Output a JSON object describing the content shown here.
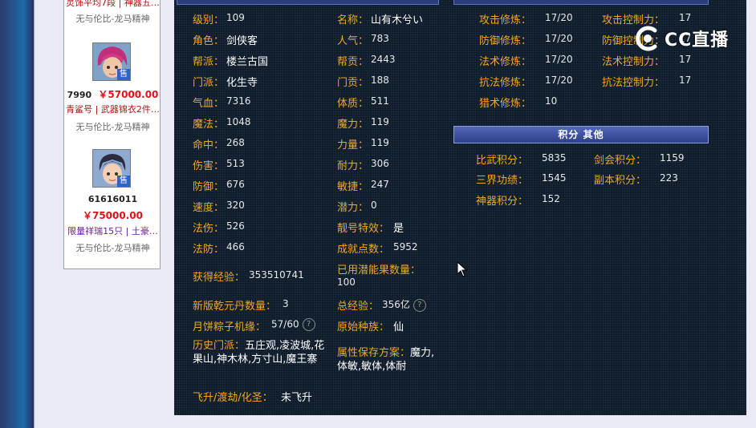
{
  "sidebar": {
    "top_cut_text": "灵饰平均7段 | 神器五…",
    "seller_name": "无与伦比-龙马精神",
    "item1": {
      "id": "7990",
      "price": "￥57000.00",
      "desc": "青鲨号 | 武器锦衣2件…",
      "seller": "无与伦比-龙马精神",
      "badge": "售"
    },
    "item2": {
      "id": "61616011",
      "price": "￥75000.00",
      "desc": "限量祥瑞15只 | 土豪…",
      "seller": "无与伦比-龙马精神",
      "badge": "售"
    }
  },
  "stats": {
    "level": {
      "label": "级别：",
      "value": "109"
    },
    "name": {
      "label": "名称：",
      "value": "山有木兮い"
    },
    "role": {
      "label": "角色：",
      "value": "剑侠客"
    },
    "popularity": {
      "label": "人气：",
      "value": "783"
    },
    "gang": {
      "label": "帮派：",
      "value": "楼兰古国"
    },
    "gang_contrib": {
      "label": "帮贡：",
      "value": "2443"
    },
    "school": {
      "label": "门派：",
      "value": "化生寺"
    },
    "school_contrib": {
      "label": "门贡：",
      "value": "188"
    },
    "hp": {
      "label": "气血：",
      "value": "7316"
    },
    "physique": {
      "label": "体质：",
      "value": "511"
    },
    "mp": {
      "label": "魔法：",
      "value": "1048"
    },
    "magic": {
      "label": "魔力：",
      "value": "119"
    },
    "hit": {
      "label": "命中：",
      "value": "268"
    },
    "strength": {
      "label": "力量：",
      "value": "119"
    },
    "damage": {
      "label": "伤害：",
      "value": "513"
    },
    "endurance": {
      "label": "耐力：",
      "value": "306"
    },
    "defense": {
      "label": "防御：",
      "value": "676"
    },
    "agility": {
      "label": "敏捷：",
      "value": "247"
    },
    "speed": {
      "label": "速度：",
      "value": "320"
    },
    "potential": {
      "label": "潜力：",
      "value": "0"
    },
    "spell_damage": {
      "label": "法伤：",
      "value": "526"
    },
    "special_number": {
      "label": "靓号特效：",
      "value": "是"
    },
    "spell_defense": {
      "label": "法防：",
      "value": "466"
    },
    "achievement": {
      "label": "成就点数：",
      "value": "5952"
    },
    "exp": {
      "label": "获得经验：",
      "value": "353510741"
    },
    "used_potential_fruit": {
      "label": "已用潜能果数量：",
      "value": "100"
    },
    "qianyuan": {
      "label": "新版乾元丹数量：",
      "value": "3"
    },
    "total_exp": {
      "label": "总经验：",
      "value": "356亿"
    },
    "mooncake": {
      "label": "月饼粽子机缘：",
      "value": "57/60"
    },
    "race": {
      "label": "原始种族：",
      "value": "仙"
    },
    "history_school": {
      "label": "历史门派：",
      "value": "五庄观,凌波城,花果山,神木林,方寸山,魔王寨"
    },
    "attr_scheme": {
      "label": "属性保存方案：",
      "value": "魔力,体敏,敏体,体耐"
    },
    "ascension": {
      "label": "飞升/渡劫/化圣：",
      "value": "未飞升"
    },
    "help_icon": "?"
  },
  "cultivation": {
    "attack": {
      "label": "攻击修炼：",
      "value": "17/20"
    },
    "attack_control": {
      "label": "攻击控制力：",
      "value": "17"
    },
    "defense": {
      "label": "防御修炼：",
      "value": "17/20"
    },
    "defense_control": {
      "label": "防御控制力：",
      "value": "17"
    },
    "spell": {
      "label": "法术修炼：",
      "value": "17/20"
    },
    "spell_control": {
      "label": "法术控制力：",
      "value": "17"
    },
    "resist": {
      "label": "抗法修炼：",
      "value": "17/20"
    },
    "resist_control": {
      "label": "抗法控制力：",
      "value": "17"
    },
    "hunt": {
      "label": "猎术修炼：",
      "value": "10"
    }
  },
  "points": {
    "header": "积分  其他",
    "pvp": {
      "label": "比武积分：",
      "value": "5835"
    },
    "sword": {
      "label": "剑会积分：",
      "value": "1159"
    },
    "sanjie": {
      "label": "三界功绩：",
      "value": "1545"
    },
    "dungeon": {
      "label": "副本积分：",
      "value": "223"
    },
    "artifact": {
      "label": "神器积分：",
      "value": "152"
    }
  },
  "watermark": {
    "text": "CC直播"
  },
  "colors": {
    "label": "#f0a829",
    "panel_bg": "#0d1b2a",
    "header": "#3a4f9c",
    "price": "#e0101a"
  }
}
